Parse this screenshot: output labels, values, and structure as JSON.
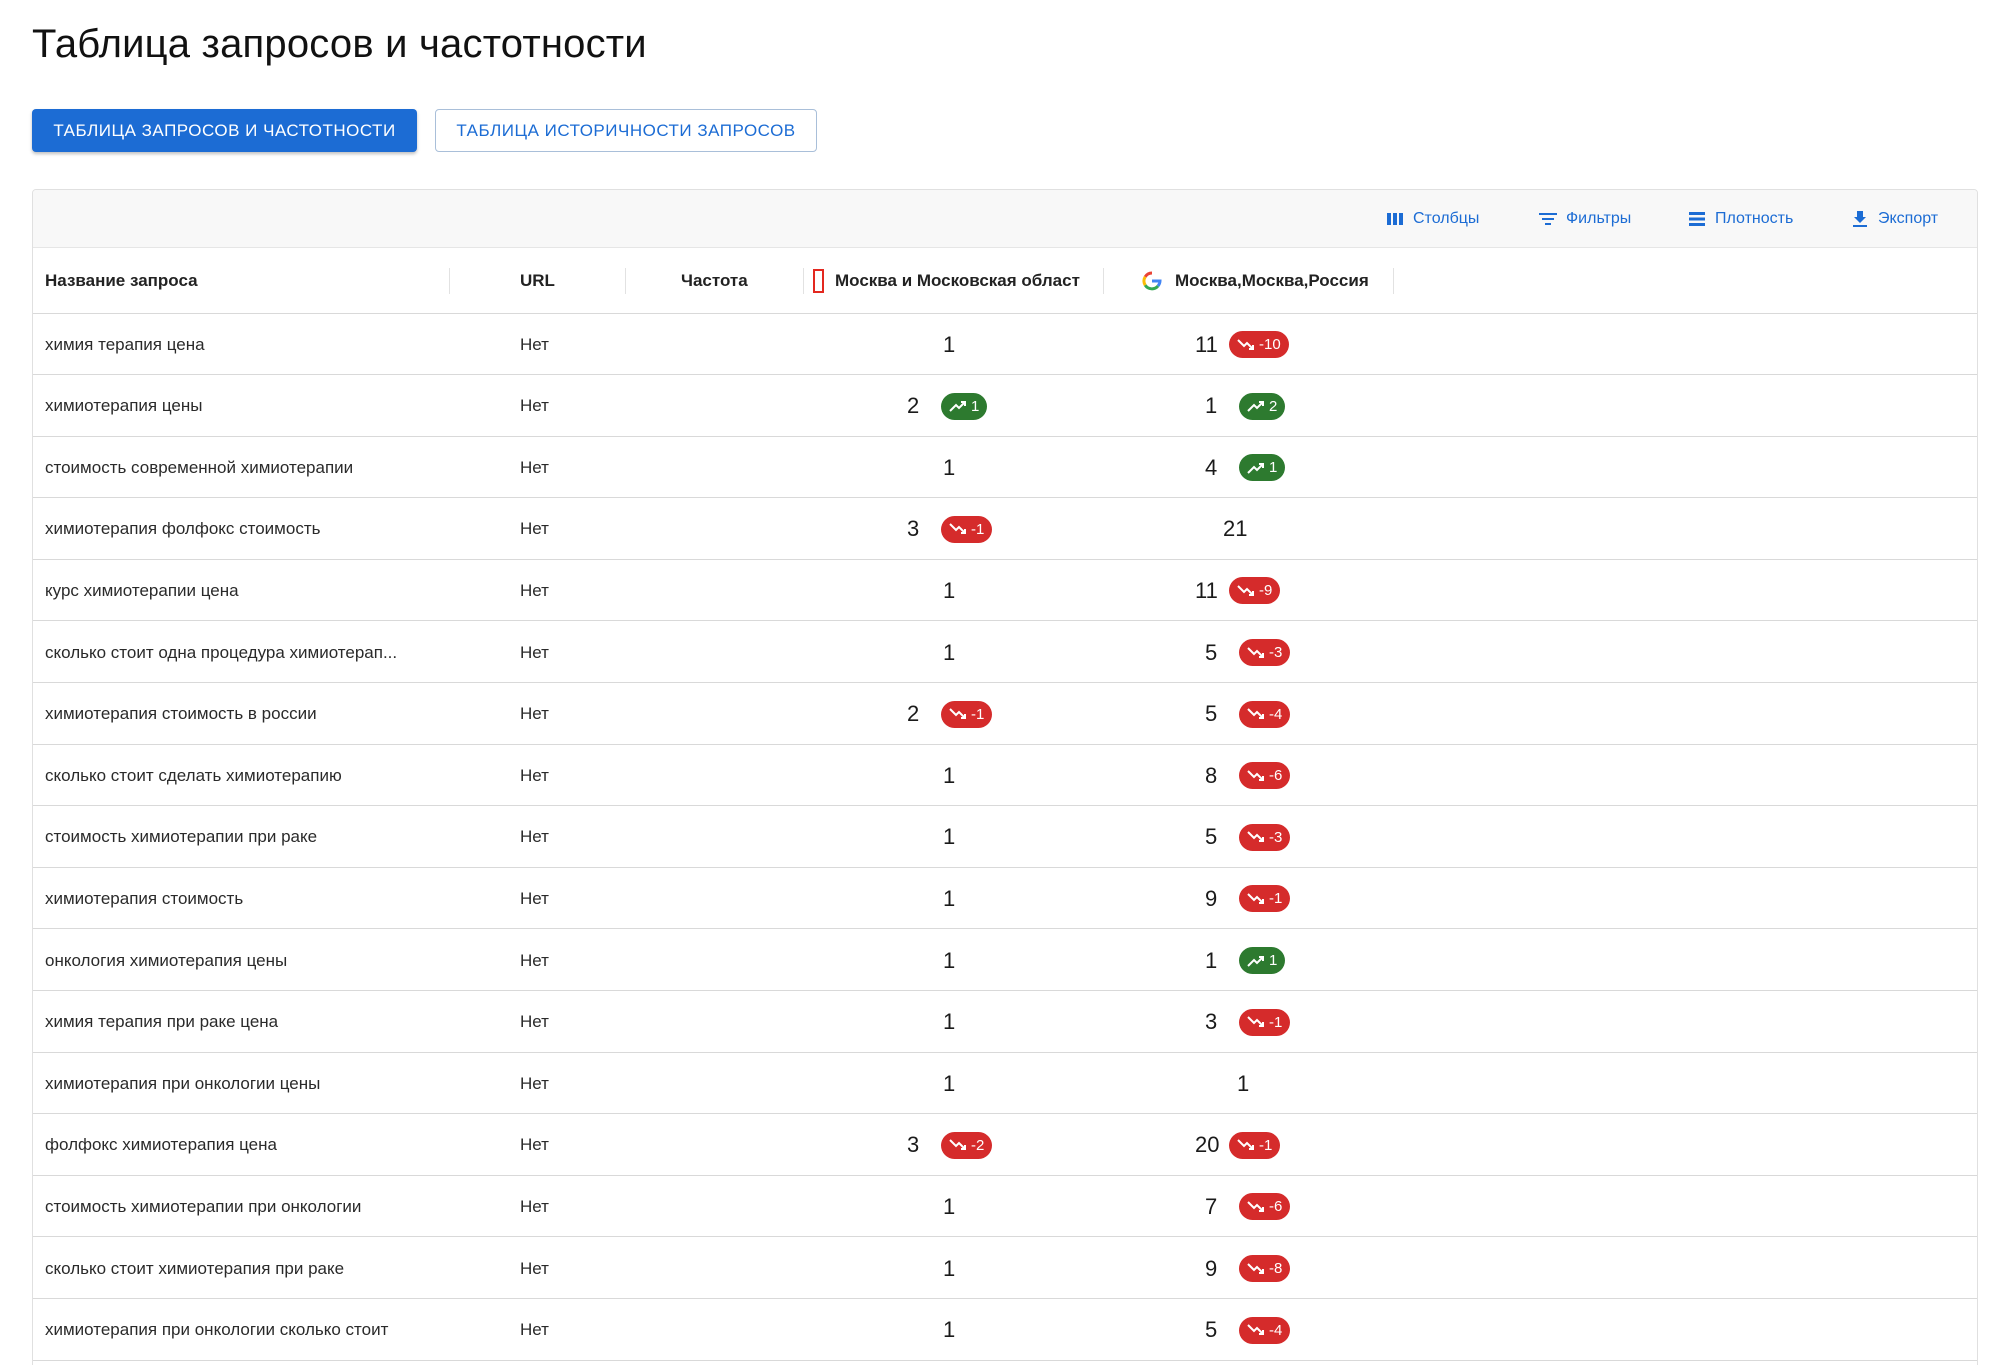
{
  "page_title": "Таблица запросов и частотности",
  "tabs": [
    {
      "label": "ТАБЛИЦА ЗАПРОСОВ И ЧАСТОТНОСТИ",
      "active": true
    },
    {
      "label": "ТАБЛИЦА ИСТОРИЧНОСТИ ЗАПРОСОВ",
      "active": false
    }
  ],
  "toolbar": {
    "columns": "Столбцы",
    "filters": "Фильтры",
    "density": "Плотность",
    "export": "Экспорт"
  },
  "columns": {
    "query": "Название запроса",
    "url": "URL",
    "frequency": "Частота",
    "yandex": "Москва и Московская област",
    "google": "Москва,Москва,Россия"
  },
  "colors": {
    "accent": "#1c6cd4",
    "down": "#d52b2b",
    "up": "#2d7a2f",
    "yandex": "#e3281f"
  },
  "rows": [
    {
      "query": "химия терапия цена",
      "url": "Нет",
      "yandex": "1",
      "yandex_delta": "",
      "yandex_dir": "",
      "google": "11",
      "google_delta": "-10",
      "google_dir": "down"
    },
    {
      "query": "химиотерапия цены",
      "url": "Нет",
      "yandex": "2",
      "yandex_delta": "1",
      "yandex_dir": "up",
      "google": "1",
      "google_delta": "2",
      "google_dir": "up"
    },
    {
      "query": "стоимость современной химиотерапии",
      "url": "Нет",
      "yandex": "1",
      "yandex_delta": "",
      "yandex_dir": "",
      "google": "4",
      "google_delta": "1",
      "google_dir": "up"
    },
    {
      "query": "химиотерапия фолфокс стоимость",
      "url": "Нет",
      "yandex": "3",
      "yandex_delta": "-1",
      "yandex_dir": "down",
      "google": "21",
      "google_delta": "",
      "google_dir": ""
    },
    {
      "query": "курс химиотерапии цена",
      "url": "Нет",
      "yandex": "1",
      "yandex_delta": "",
      "yandex_dir": "",
      "google": "11",
      "google_delta": "-9",
      "google_dir": "down"
    },
    {
      "query": "сколько стоит одна процедура химиотерап...",
      "url": "Нет",
      "yandex": "1",
      "yandex_delta": "",
      "yandex_dir": "",
      "google": "5",
      "google_delta": "-3",
      "google_dir": "down"
    },
    {
      "query": "химиотерапия стоимость в россии",
      "url": "Нет",
      "yandex": "2",
      "yandex_delta": "-1",
      "yandex_dir": "down",
      "google": "5",
      "google_delta": "-4",
      "google_dir": "down"
    },
    {
      "query": "сколько стоит сделать химиотерапию",
      "url": "Нет",
      "yandex": "1",
      "yandex_delta": "",
      "yandex_dir": "",
      "google": "8",
      "google_delta": "-6",
      "google_dir": "down"
    },
    {
      "query": "стоимость химиотерапии при раке",
      "url": "Нет",
      "yandex": "1",
      "yandex_delta": "",
      "yandex_dir": "",
      "google": "5",
      "google_delta": "-3",
      "google_dir": "down"
    },
    {
      "query": "химиотерапия стоимость",
      "url": "Нет",
      "yandex": "1",
      "yandex_delta": "",
      "yandex_dir": "",
      "google": "9",
      "google_delta": "-1",
      "google_dir": "down"
    },
    {
      "query": "онкология химиотерапия цены",
      "url": "Нет",
      "yandex": "1",
      "yandex_delta": "",
      "yandex_dir": "",
      "google": "1",
      "google_delta": "1",
      "google_dir": "up"
    },
    {
      "query": "химия терапия при раке цена",
      "url": "Нет",
      "yandex": "1",
      "yandex_delta": "",
      "yandex_dir": "",
      "google": "3",
      "google_delta": "-1",
      "google_dir": "down"
    },
    {
      "query": "химиотерапия при онкологии цены",
      "url": "Нет",
      "yandex": "1",
      "yandex_delta": "",
      "yandex_dir": "",
      "google": "1",
      "google_delta": "",
      "google_dir": ""
    },
    {
      "query": "фолфокс химиотерапия цена",
      "url": "Нет",
      "yandex": "3",
      "yandex_delta": "-2",
      "yandex_dir": "down",
      "google": "20",
      "google_delta": "-1",
      "google_dir": "down"
    },
    {
      "query": "стоимость химиотерапии при онкологии",
      "url": "Нет",
      "yandex": "1",
      "yandex_delta": "",
      "yandex_dir": "",
      "google": "7",
      "google_delta": "-6",
      "google_dir": "down"
    },
    {
      "query": "сколько стоит химиотерапия при раке",
      "url": "Нет",
      "yandex": "1",
      "yandex_delta": "",
      "yandex_dir": "",
      "google": "9",
      "google_delta": "-8",
      "google_dir": "down"
    },
    {
      "query": "химиотерапия при онкологии сколько стоит",
      "url": "Нет",
      "yandex": "1",
      "yandex_delta": "",
      "yandex_dir": "",
      "google": "5",
      "google_delta": "-4",
      "google_dir": "down"
    }
  ]
}
